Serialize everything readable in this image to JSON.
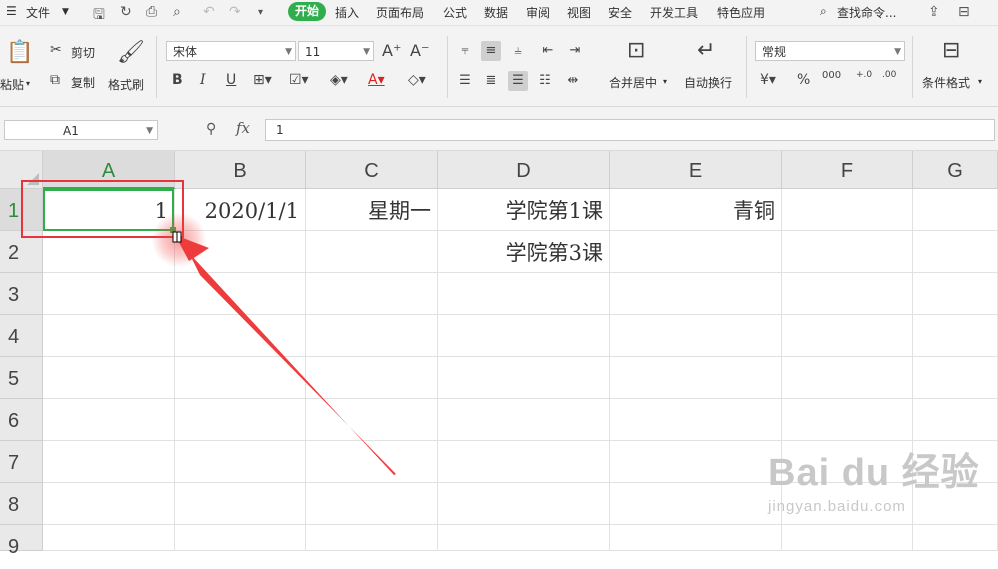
{
  "menu": {
    "file": "文件",
    "tabs": [
      "开始",
      "插入",
      "页面布局",
      "公式",
      "数据",
      "审阅",
      "视图",
      "安全",
      "开发工具",
      "特色应用"
    ],
    "active_tab": "开始",
    "search": "查找命令..."
  },
  "ribbon": {
    "paste": "粘贴",
    "cut": "剪切",
    "copy": "复制",
    "format_painter": "格式刷",
    "font_name": "宋体",
    "font_size": "11",
    "merge_center": "合并居中",
    "wrap_text": "自动换行",
    "number_format": "常规",
    "conditional_format": "条件格式"
  },
  "formula_bar": {
    "name_box": "A1",
    "fx": "fx",
    "value": "1"
  },
  "sheet": {
    "columns": [
      "A",
      "B",
      "C",
      "D",
      "E",
      "F",
      "G"
    ],
    "rows": [
      "1",
      "2",
      "3",
      "4",
      "5",
      "6",
      "7",
      "8",
      "9"
    ],
    "cells": {
      "A1": "1",
      "B1": "2020/1/1",
      "C1": "星期一",
      "D1": "学院第1课",
      "E1": "青铜",
      "D2": "学院第3课"
    },
    "selected": "A1"
  },
  "colors": {
    "accent": "#2fae4b",
    "annotation": "#e8323c"
  },
  "watermark": {
    "logo": "Bai du 经验",
    "url": "jingyan.baidu.com"
  }
}
